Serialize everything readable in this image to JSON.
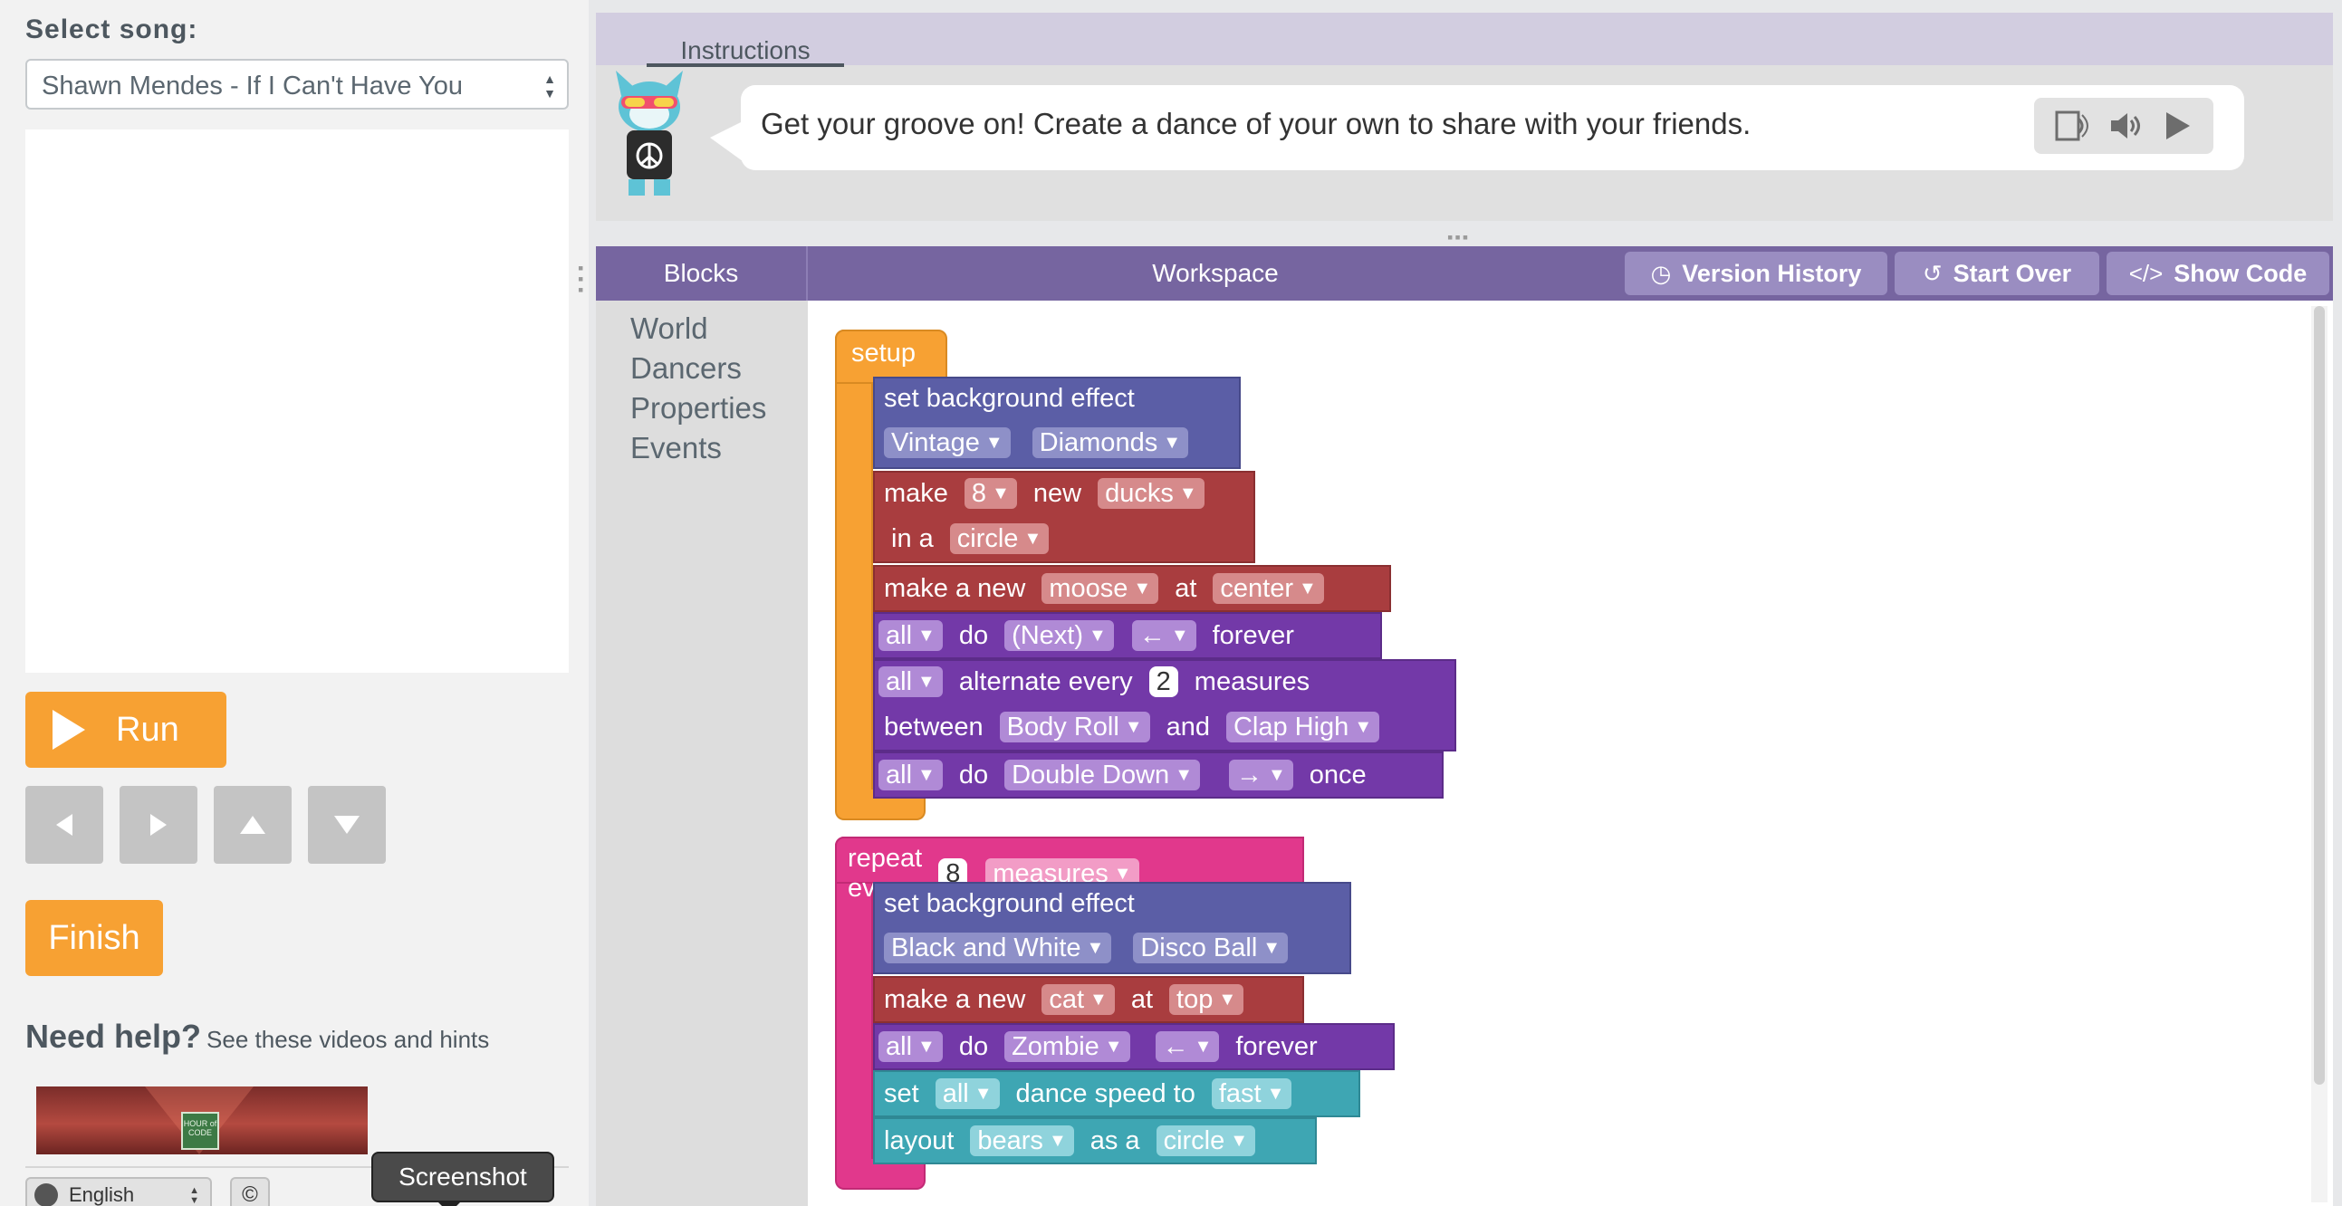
{
  "left": {
    "select_label": "Select song:",
    "song": "Shawn Mendes - If I Can't Have You",
    "run_label": "Run",
    "finish_label": "Finish",
    "help_title": "Need help?",
    "help_text": "See these videos and hints",
    "video_logo": "HOUR of CODE",
    "language": "English",
    "copyright": "©",
    "tooltip": "Screenshot"
  },
  "instructions": {
    "tab": "Instructions",
    "text": "Get your groove on! Create a dance of your own to share with your friends."
  },
  "workspace_header": {
    "blocks": "Blocks",
    "workspace": "Workspace",
    "version_history": "Version History",
    "start_over": "Start Over",
    "show_code": "Show Code"
  },
  "toolbox": [
    "World",
    "Dancers",
    "Properties",
    "Events"
  ],
  "colors": {
    "orange": "#f7a133",
    "bg_effect": "#5b5ea6",
    "sprite": "#a93d3f",
    "dance": "#7339a8",
    "events": "#e1388c",
    "layout": "#3ea6b3",
    "header": "#7665a0"
  },
  "program": {
    "setup": {
      "hat": "setup",
      "bg1": {
        "label": "set background effect",
        "palette": "Vintage",
        "effect": "Diamonds"
      },
      "make": {
        "w1": "make",
        "count": "8",
        "w2": "new",
        "kind": "ducks",
        "w3": "in a",
        "shape": "circle"
      },
      "make_new": {
        "w1": "make a new",
        "kind": "moose",
        "w2": "at",
        "pos": "center"
      },
      "do1": {
        "who": "all",
        "w1": "do",
        "move": "(Next)",
        "dir": "←",
        "w2": "forever"
      },
      "alt": {
        "who": "all",
        "w1": "alternate every",
        "n": "2",
        "w2": "measures",
        "w3": "between",
        "m1": "Body Roll",
        "w4": "and",
        "m2": "Clap High"
      },
      "do2": {
        "who": "all",
        "w1": "do",
        "move": "Double Down",
        "dir": "→",
        "w2": "once"
      }
    },
    "repeat": {
      "w1": "repeat every",
      "n": "8",
      "unit": "measures",
      "bg2": {
        "label": "set background effect",
        "palette": "Black and White",
        "effect": "Disco Ball"
      },
      "make_new": {
        "w1": "make a new",
        "kind": "cat",
        "w2": "at",
        "pos": "top"
      },
      "do": {
        "who": "all",
        "w1": "do",
        "move": "Zombie",
        "dir": "←",
        "w2": "forever"
      },
      "speed": {
        "w1": "set",
        "who": "all",
        "w2": "dance speed to",
        "val": "fast"
      },
      "layout": {
        "w1": "layout",
        "kind": "bears",
        "w2": "as a",
        "shape": "circle"
      }
    }
  }
}
